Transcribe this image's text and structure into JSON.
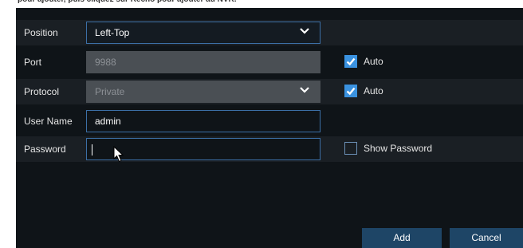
{
  "caption": "pour ajouter, puis cliquez sur Recho pour ajouter au NVR.",
  "form": {
    "position": {
      "label": "Position",
      "value": "Left-Top"
    },
    "port": {
      "label": "Port",
      "value": "9988",
      "auto_label": "Auto",
      "auto_checked": true
    },
    "protocol": {
      "label": "Protocol",
      "value": "Private",
      "auto_label": "Auto",
      "auto_checked": true
    },
    "username": {
      "label": "User Name",
      "value": "admin"
    },
    "password": {
      "label": "Password",
      "value": "",
      "show_label": "Show Password",
      "show_checked": false
    }
  },
  "buttons": {
    "add": "Add",
    "cancel": "Cancel"
  },
  "icons": [
    "chevron-down-icon",
    "checkmark-icon",
    "mouse-pointer-icon"
  ],
  "colors": {
    "panel_bg": "#0f1418",
    "row_alt": "#1a1f24",
    "accent": "#3a92e0",
    "border": "#3c6fa6",
    "button_bg": "#1e4566"
  }
}
